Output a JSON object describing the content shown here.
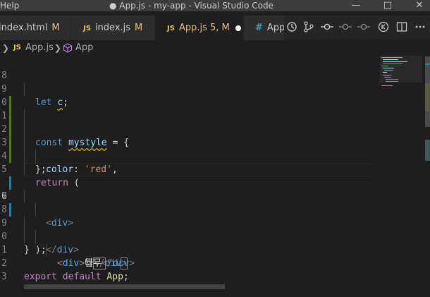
{
  "titlebar": {
    "menu": [
      "Help"
    ],
    "window_title": "● App.js - my-app - Visual Studio Code",
    "minimize_icon": "minimize-icon",
    "maximize_icon": "maximize-icon",
    "close_icon": "close-icon"
  },
  "tabs": [
    {
      "icon": "",
      "label": "index.html",
      "status": "M"
    },
    {
      "icon": "JS",
      "label": "index.js",
      "status": "M"
    },
    {
      "icon": "JS",
      "label": "App.js",
      "status": "5, M"
    },
    {
      "icon": "#",
      "label": "App"
    }
  ],
  "editor_actions": [
    "history-icon",
    "source-control-icon",
    "git-commit-icon",
    "previous-change-icon",
    "next-change-icon",
    "timeline-icon",
    "split-editor-icon",
    "more-icon"
  ],
  "breadcrumb": {
    "file_icon": "JS",
    "file": "App.js",
    "symbol_icon": "cube-icon",
    "symbol": "App"
  },
  "code": {
    "ln8": "8",
    "ln9": "9",
    "ln10": "0",
    "ln11": "1",
    "ln12": "2",
    "ln13": "3",
    "ln14": "4",
    "ln15": "5",
    "ln16": "6",
    "ln17": "7",
    "ln18": "8",
    "ln19": "9",
    "ln20": "0",
    "ln21": "1",
    "ln22": "2",
    "ln23": "3",
    "let": "let",
    "c_var": "c",
    "semi": ";",
    "const": "const",
    "mystyle": "mystyle",
    "eq_brace": " = {",
    "color_key": "color",
    "colon": ": ",
    "red": "'red'",
    "comma": ",",
    "close_brace": "};",
    "return": "return",
    "paren_open": " (",
    "lt": "<",
    "gt": ">",
    "lt_slash": "</",
    "div": "div",
    "text1": "뭘",
    "text2": "나무",
    "close_paren": ");",
    "close_fn": "}",
    "export": "export",
    "default": "default",
    "app": "App"
  },
  "colors": {
    "accent": "#007acc",
    "modified": "#e2c08d",
    "js": "#e7c73d"
  }
}
